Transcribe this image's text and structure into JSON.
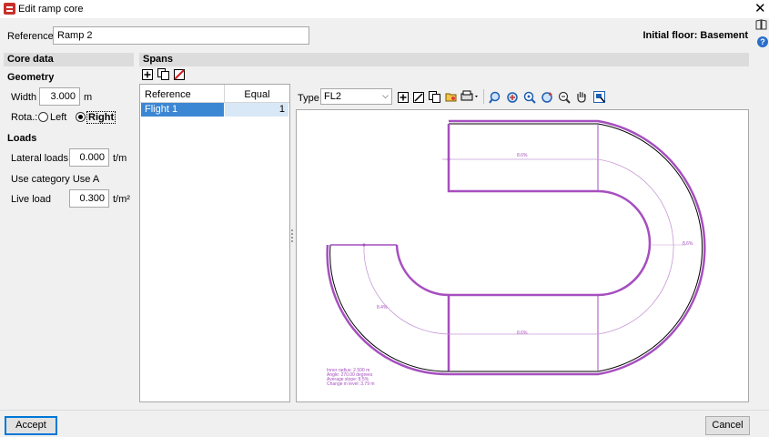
{
  "window": {
    "title": "Edit ramp core"
  },
  "reference": {
    "label": "Reference",
    "value": "Ramp 2"
  },
  "initial_floor": "Initial floor: Basement",
  "core_data": {
    "header": "Core data",
    "geometry_title": "Geometry",
    "width_label": "Width",
    "width_value": "3.000",
    "width_unit": "m",
    "rota_label": "Rota.:",
    "left_label": "Left",
    "right_label": "Right",
    "rotation_selected": "Right",
    "loads_title": "Loads",
    "lateral_label": "Lateral loads",
    "lateral_value": "0.000",
    "lateral_unit": "t/m",
    "use_category": "Use category Use A",
    "live_label": "Live load",
    "live_value": "0.300",
    "live_unit": "t/m²"
  },
  "spans": {
    "header": "Spans",
    "columns": [
      "Reference",
      "Equal"
    ],
    "rows": [
      {
        "reference": "Flight 1",
        "equal": "1",
        "selected": true
      }
    ]
  },
  "viewer": {
    "type_label": "Type",
    "type_value": "FL2",
    "slope_top": "8.6%",
    "slope_right": "8.6%",
    "slope_left": "8.4%",
    "slope_bottom": "8.6%",
    "info_lines": [
      "Inner radius: 2.500 m",
      "Angle: 270.00 degrees",
      "Average slope: 8.5%",
      "Change in level: 3.79 m"
    ]
  },
  "colors": {
    "ramp_outline": "#a64fbf",
    "selection": "#3c87d4",
    "accent": "#0078d7"
  },
  "buttons": {
    "accept": "Accept",
    "cancel": "Cancel"
  }
}
